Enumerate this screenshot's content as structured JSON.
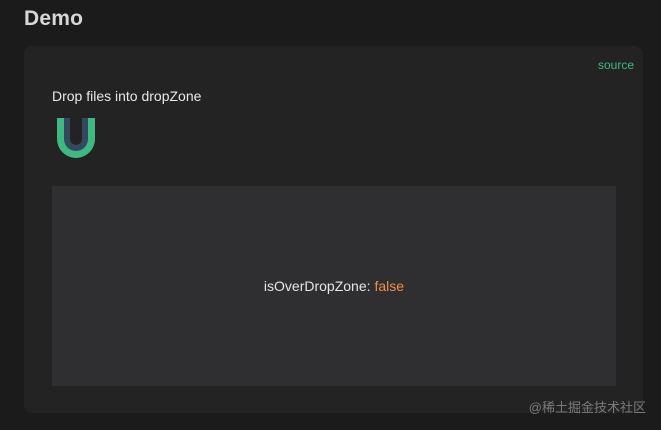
{
  "page": {
    "title": "Demo"
  },
  "demo": {
    "source_label": "source",
    "instruction": "Drop files into dropZone",
    "logo_icon": "vueuse-logo-icon",
    "dropzone": {
      "status_label": "isOverDropZone:",
      "status_value": "false"
    }
  },
  "watermark": "@稀土掘金技术社区",
  "colors": {
    "accent": "#3fb981",
    "value_false": "#f08d49",
    "card_bg": "#232323",
    "dropzone_bg": "#2f2f31",
    "page_bg": "#1b1b1b"
  }
}
